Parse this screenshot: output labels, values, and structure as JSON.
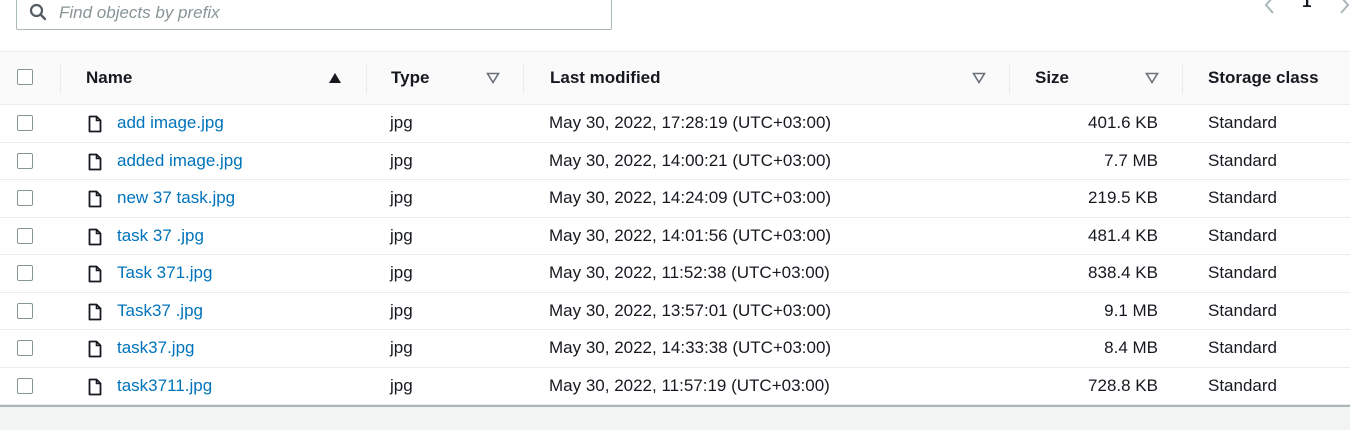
{
  "search": {
    "placeholder": "Find objects by prefix",
    "value": ""
  },
  "pagination": {
    "current_page": "1"
  },
  "columns": {
    "name": "Name",
    "type": "Type",
    "last_modified": "Last modified",
    "size": "Size",
    "storage_class": "Storage class"
  },
  "sort": {
    "column": "name",
    "direction": "ascending"
  },
  "rows": [
    {
      "name": "add image.jpg",
      "type": "jpg",
      "last_modified": "May 30, 2022, 17:28:19 (UTC+03:00)",
      "size": "401.6 KB",
      "storage_class": "Standard"
    },
    {
      "name": "added image.jpg",
      "type": "jpg",
      "last_modified": "May 30, 2022, 14:00:21 (UTC+03:00)",
      "size": "7.7 MB",
      "storage_class": "Standard"
    },
    {
      "name": "new 37 task.jpg",
      "type": "jpg",
      "last_modified": "May 30, 2022, 14:24:09 (UTC+03:00)",
      "size": "219.5 KB",
      "storage_class": "Standard"
    },
    {
      "name": "task 37 .jpg",
      "type": "jpg",
      "last_modified": "May 30, 2022, 14:01:56 (UTC+03:00)",
      "size": "481.4 KB",
      "storage_class": "Standard"
    },
    {
      "name": "Task 371.jpg",
      "type": "jpg",
      "last_modified": "May 30, 2022, 11:52:38 (UTC+03:00)",
      "size": "838.4 KB",
      "storage_class": "Standard"
    },
    {
      "name": "Task37 .jpg",
      "type": "jpg",
      "last_modified": "May 30, 2022, 13:57:01 (UTC+03:00)",
      "size": "9.1 MB",
      "storage_class": "Standard"
    },
    {
      "name": "task37.jpg",
      "type": "jpg",
      "last_modified": "May 30, 2022, 14:33:38 (UTC+03:00)",
      "size": "8.4 MB",
      "storage_class": "Standard"
    },
    {
      "name": "task3711.jpg",
      "type": "jpg",
      "last_modified": "May 30, 2022, 11:57:19 (UTC+03:00)",
      "size": "728.8 KB",
      "storage_class": "Standard"
    }
  ],
  "icons": {
    "search": "search-icon",
    "prev": "chevron-left-icon",
    "next": "chevron-right-icon",
    "sort_active": "caret-up-icon",
    "sort_inactive": "caret-down-outline-icon",
    "file": "file-icon"
  },
  "colors": {
    "link": "#0073bb",
    "text": "#16191f",
    "border": "#aab7b8"
  }
}
